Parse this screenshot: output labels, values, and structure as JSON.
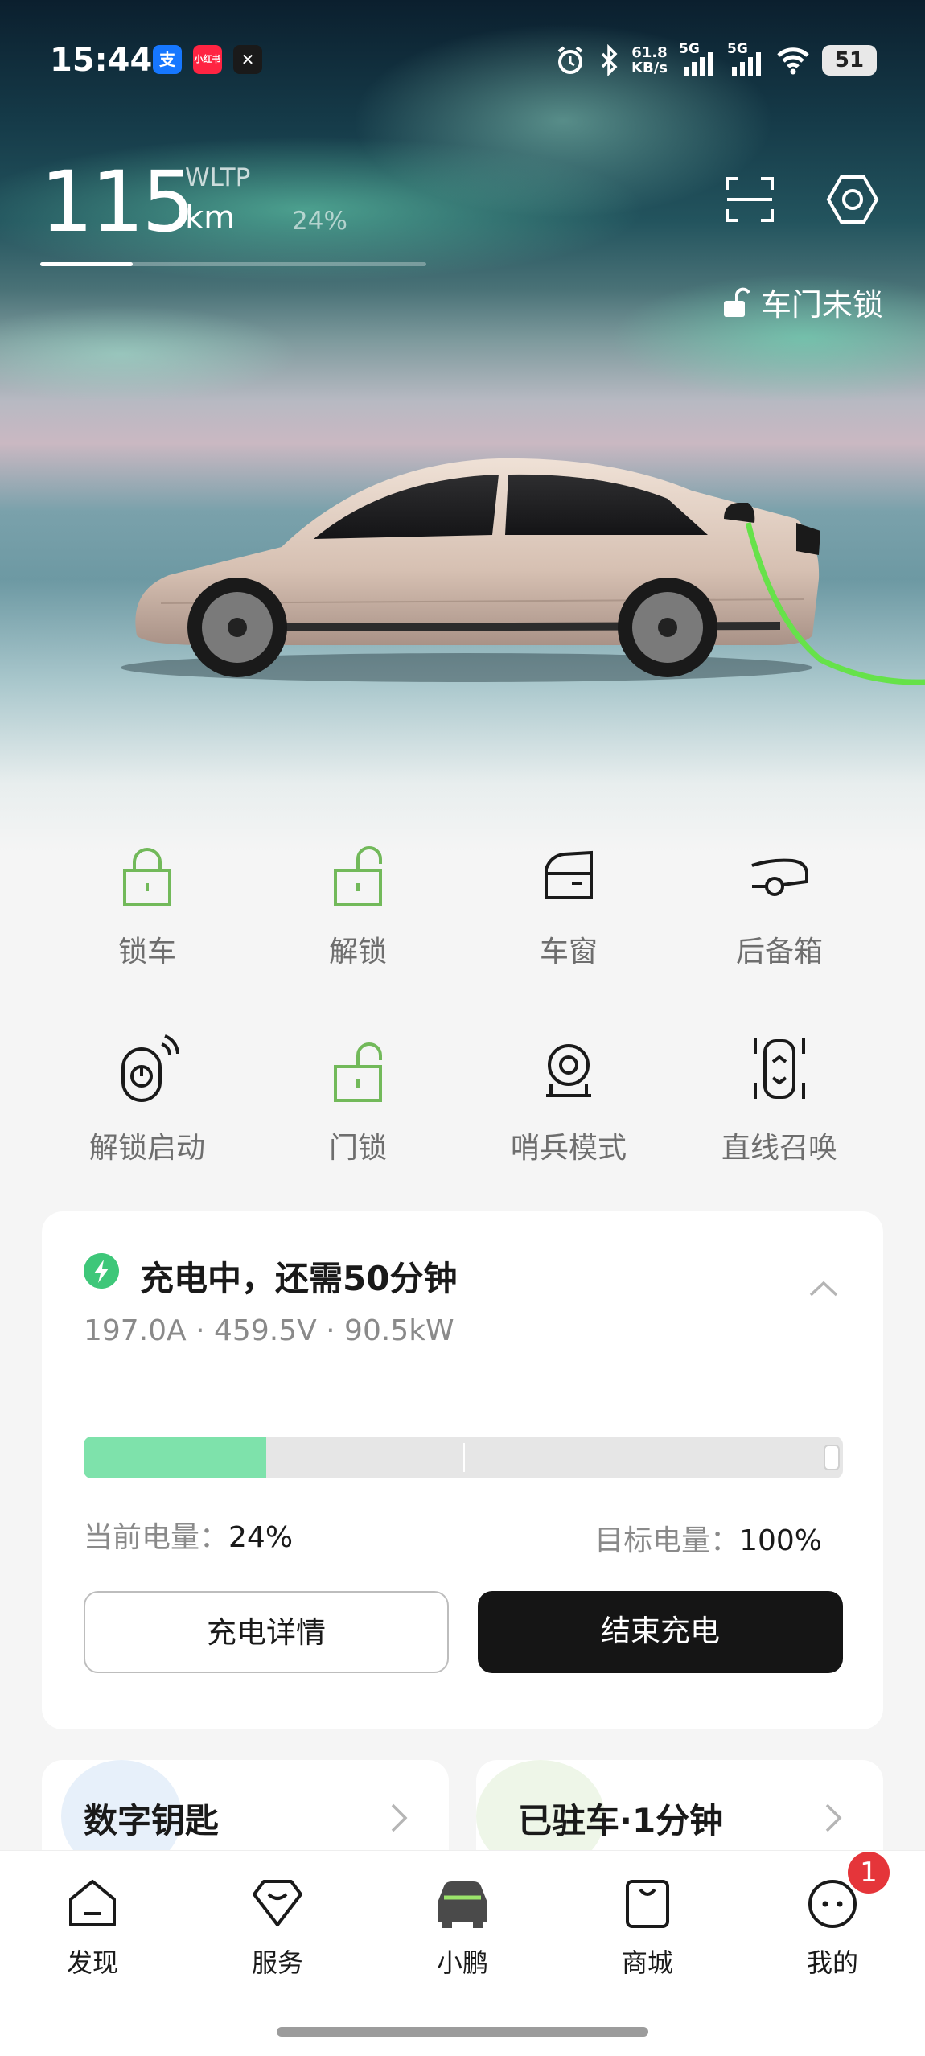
{
  "status_bar": {
    "time": "15:44",
    "app_icons": [
      {
        "name": "alipay-icon",
        "glyph": "支",
        "color": "#1677ff"
      },
      {
        "name": "xiaohongshu-icon",
        "glyph": "小红书",
        "color": "#ff2442"
      },
      {
        "name": "xpeng-icon",
        "glyph": "✕",
        "color": "#1a1a1a"
      }
    ],
    "net_speed": "61.8",
    "net_unit": "KB/s",
    "signal_1": "5G",
    "signal_2": "5G",
    "battery": "51"
  },
  "range": {
    "value": "115",
    "unit": "km",
    "standard": "WLTP",
    "battery_percent": "24%",
    "battery_fraction": 0.24
  },
  "door_status": "车门未锁",
  "controls": [
    {
      "key": "lock",
      "label": "锁车",
      "icon": "lock-icon"
    },
    {
      "key": "unlock",
      "label": "解锁",
      "icon": "unlock-icon"
    },
    {
      "key": "window",
      "label": "车窗",
      "icon": "window-icon"
    },
    {
      "key": "trunk",
      "label": "后备箱",
      "icon": "trunk-icon"
    },
    {
      "key": "unlock_start",
      "label": "解锁启动",
      "icon": "key-fob-icon"
    },
    {
      "key": "door_lock",
      "label": "门锁",
      "icon": "unlock-icon"
    },
    {
      "key": "sentry",
      "label": "哨兵模式",
      "icon": "sentry-camera-icon"
    },
    {
      "key": "summon",
      "label": "直线召唤",
      "icon": "summon-icon"
    }
  ],
  "charging": {
    "title": "充电中，还需50分钟",
    "info": "197.0A · 459.5V · 90.5kW",
    "current_label": "当前电量：",
    "current_value": "24%",
    "current_fraction": 0.24,
    "target_label": "目标电量：",
    "target_value": "100%",
    "details_button": "充电详情",
    "stop_button": "结束充电"
  },
  "mini_cards": [
    {
      "title": "数字钥匙"
    },
    {
      "title": "已驻车·1分钟"
    }
  ],
  "nav": [
    {
      "label": "发现",
      "icon": "discover-icon"
    },
    {
      "label": "服务",
      "icon": "service-icon"
    },
    {
      "label": "小鹏",
      "icon": "car-icon",
      "active": true
    },
    {
      "label": "商城",
      "icon": "shop-icon"
    },
    {
      "label": "我的",
      "icon": "profile-icon",
      "badge": "1"
    }
  ],
  "colors": {
    "accent_green": "#7ee2ab",
    "icon_green": "#72b95a",
    "bolt_green": "#3ec779",
    "badge_red": "#e5353a",
    "dark_button": "#151515"
  }
}
